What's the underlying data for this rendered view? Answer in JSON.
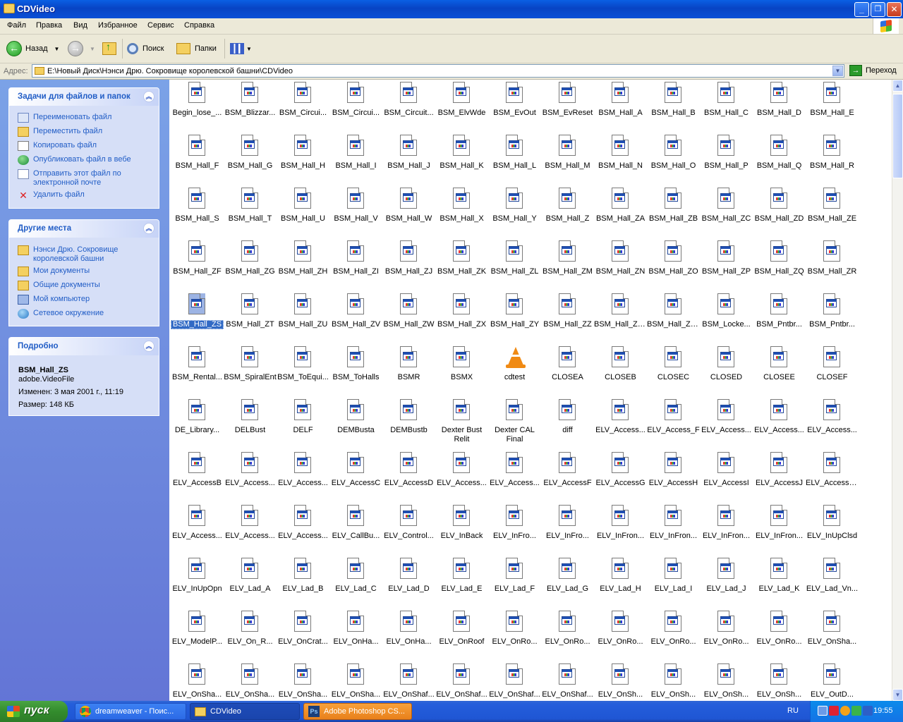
{
  "window": {
    "title": "CDVideo",
    "minimize_label": "_",
    "maximize_label": "❐",
    "close_label": "✕"
  },
  "menu": [
    "Файл",
    "Правка",
    "Вид",
    "Избранное",
    "Сервис",
    "Справка"
  ],
  "toolbar": {
    "back_label": "Назад",
    "search_label": "Поиск",
    "folders_label": "Папки"
  },
  "address": {
    "label": "Адрес:",
    "value": "E:\\Новый Диск\\Нэнси Дрю. Сокровище королевской башни\\CDVideo",
    "go_label": "Переход"
  },
  "tasks_panel": {
    "title": "Задачи для файлов и папок",
    "items": [
      {
        "label": "Переименовать файл",
        "icon": "rename-icon"
      },
      {
        "label": "Переместить файл",
        "icon": "move-icon"
      },
      {
        "label": "Копировать файл",
        "icon": "copy-icon"
      },
      {
        "label": "Опубликовать файл в вебе",
        "icon": "globe-icon"
      },
      {
        "label": "Отправить этот файл по электронной почте",
        "icon": "email-icon"
      },
      {
        "label": "Удалить файл",
        "icon": "delete-icon"
      }
    ]
  },
  "places_panel": {
    "title": "Другие места",
    "items": [
      {
        "label": "Нэнси Дрю. Сокровище королевской башни",
        "icon": "folder-icon"
      },
      {
        "label": "Мои документы",
        "icon": "folder-icon"
      },
      {
        "label": "Общие документы",
        "icon": "folder-icon"
      },
      {
        "label": "Мой компьютер",
        "icon": "computer-icon"
      },
      {
        "label": "Сетевое окружение",
        "icon": "network-icon"
      }
    ]
  },
  "details_panel": {
    "title": "Подробно",
    "name": "BSM_Hall_ZS",
    "type": "adobe.VideoFile",
    "modified": "Изменен: 3 мая 2001 г., 11:19",
    "size": "Размер: 148 КБ"
  },
  "files": [
    "Begin_lose_...",
    "BSM_Blizzar...",
    "BSM_Circui...",
    "BSM_Circui...",
    "BSM_Circuit...",
    "BSM_ElvWde",
    "BSM_EvOut",
    "BSM_EvReset",
    "BSM_Hall_A",
    "BSM_Hall_B",
    "BSM_Hall_C",
    "BSM_Hall_D",
    "BSM_Hall_E",
    "BSM_Hall_F",
    "BSM_Hall_G",
    "BSM_Hall_H",
    "BSM_Hall_I",
    "BSM_Hall_J",
    "BSM_Hall_K",
    "BSM_Hall_L",
    "BSM_Hall_M",
    "BSM_Hall_N",
    "BSM_Hall_O",
    "BSM_Hall_P",
    "BSM_Hall_Q",
    "BSM_Hall_R",
    "BSM_Hall_S",
    "BSM_Hall_T",
    "BSM_Hall_U",
    "BSM_Hall_V",
    "BSM_Hall_W",
    "BSM_Hall_X",
    "BSM_Hall_Y",
    "BSM_Hall_Z",
    "BSM_Hall_ZA",
    "BSM_Hall_ZB",
    "BSM_Hall_ZC",
    "BSM_Hall_ZD",
    "BSM_Hall_ZE",
    "BSM_Hall_ZF",
    "BSM_Hall_ZG",
    "BSM_Hall_ZH",
    "BSM_Hall_ZI",
    "BSM_Hall_ZJ",
    "BSM_Hall_ZK",
    "BSM_Hall_ZL",
    "BSM_Hall_ZM",
    "BSM_Hall_ZN",
    "BSM_Hall_ZO",
    "BSM_Hall_ZP",
    "BSM_Hall_ZQ",
    "BSM_Hall_ZR",
    "BSM_Hall_ZS",
    "BSM_Hall_ZT",
    "BSM_Hall_ZU",
    "BSM_Hall_ZV",
    "BSM_Hall_ZW",
    "BSM_Hall_ZX",
    "BSM_Hall_ZY",
    "BSM_Hall_ZZ",
    "BSM_Hall_ZZA",
    "BSM_Hall_ZZB",
    "BSM_Locke...",
    "BSM_Pntbr...",
    "BSM_Pntbr...",
    "BSM_Rental...",
    "BSM_SpiralEnt",
    "BSM_ToEqui...",
    "BSM_ToHalls",
    "BSMR",
    "BSMX",
    "cdtest",
    "CLOSEA",
    "CLOSEB",
    "CLOSEC",
    "CLOSED",
    "CLOSEE",
    "CLOSEF",
    "DE_Library...",
    "DELBust",
    "DELF",
    "DEMBusta",
    "DEMBustb",
    "Dexter Bust Relit",
    "Dexter CAL Final",
    "diff",
    "ELV_Access...",
    "ELV_Access_F",
    "ELV_Access...",
    "ELV_Access...",
    "ELV_Access...",
    "ELV_AccessB",
    "ELV_Access...",
    "ELV_Access...",
    "ELV_AccessC",
    "ELV_AccessD",
    "ELV_Access...",
    "ELV_Access...",
    "ELV_AccessF",
    "ELV_AccessG",
    "ELV_AccessH",
    "ELV_AccessI",
    "ELV_AccessJ",
    "ELV_AccessUp",
    "ELV_Access...",
    "ELV_Access...",
    "ELV_Access...",
    "ELV_CallBu...",
    "ELV_Control...",
    "ELV_InBack",
    "ELV_InFro...",
    "ELV_InFro...",
    "ELV_InFron...",
    "ELV_InFron...",
    "ELV_InFron...",
    "ELV_InFron...",
    "ELV_InUpClsd",
    "ELV_InUpOpn",
    "ELV_Lad_A",
    "ELV_Lad_B",
    "ELV_Lad_C",
    "ELV_Lad_D",
    "ELV_Lad_E",
    "ELV_Lad_F",
    "ELV_Lad_G",
    "ELV_Lad_H",
    "ELV_Lad_I",
    "ELV_Lad_J",
    "ELV_Lad_K",
    "ELV_Lad_Vn...",
    "ELV_ModelP...",
    "ELV_On_R...",
    "ELV_OnCrat...",
    "ELV_OnHa...",
    "ELV_OnHa...",
    "ELV_OnRoof",
    "ELV_OnRo...",
    "ELV_OnRo...",
    "ELV_OnRo...",
    "ELV_OnRo...",
    "ELV_OnRo...",
    "ELV_OnRo...",
    "ELV_OnSha...",
    "ELV_OnSha...",
    "ELV_OnSha...",
    "ELV_OnSha...",
    "ELV_OnSha...",
    "ELV_OnShaf...",
    "ELV_OnShaf...",
    "ELV_OnShaf...",
    "ELV_OnShaf...",
    "ELV_OnSh...",
    "ELV_OnSh...",
    "ELV_OnSh...",
    "ELV_OnSh...",
    "ELV_OutD..."
  ],
  "selected_file": "BSM_Hall_ZS",
  "vlc_file": "cdtest",
  "taskbar": {
    "start_label": "пуск",
    "tasks": [
      {
        "label": "dreamweaver - Поис...",
        "icon": "chrome-icon"
      },
      {
        "label": "CDVideo",
        "icon": "folder-icon"
      },
      {
        "label": "Adobe Photoshop CS...",
        "icon": "photoshop-icon"
      }
    ],
    "lang": "RU",
    "clock": "19:55"
  },
  "colors": {
    "title_blue": "#0a4fd6",
    "panel_link": "#215dc6",
    "selection": "#316ac5",
    "start_green": "#338c2d"
  }
}
